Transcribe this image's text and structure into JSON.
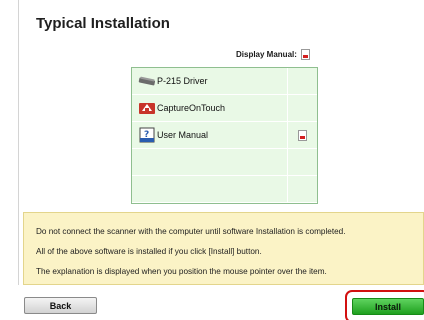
{
  "header": {
    "title": "Typical Installation"
  },
  "manual": {
    "label": "Display Manual:",
    "icon": "pdf-icon"
  },
  "software": [
    {
      "label": "P-215 Driver",
      "icon": "driver-icon",
      "has_manual": false
    },
    {
      "label": "CaptureOnTouch",
      "icon": "captureontouch-icon",
      "has_manual": false
    },
    {
      "label": "User Manual",
      "icon": "help-book-icon",
      "has_manual": true
    }
  ],
  "notice": {
    "lines": [
      "Do not connect the scanner with the computer until software Installation is completed.",
      "All of the above software is installed if you click [Install] button.",
      "The explanation is displayed when you position the mouse pointer over the item."
    ]
  },
  "buttons": {
    "back": "Back",
    "install": "Install"
  },
  "colors": {
    "table_bg": "#e9f9e6",
    "notice_bg": "#fbf3c6",
    "install_green": "#1fa01f",
    "highlight_red": "#d21010"
  }
}
